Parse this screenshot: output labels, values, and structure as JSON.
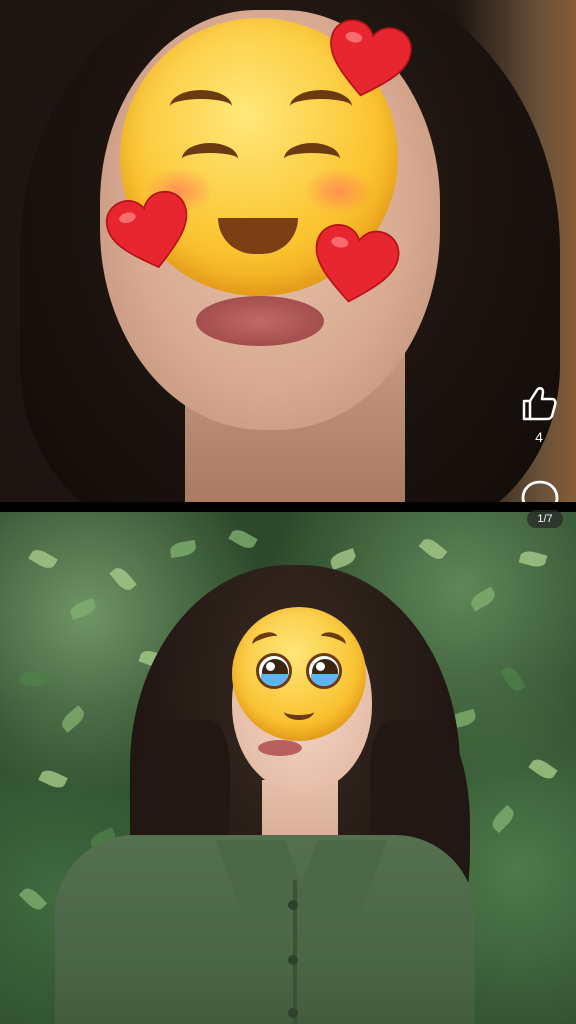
{
  "feed": {
    "post_top": {
      "emoji": "smiling-face-with-hearts",
      "actions": {
        "like_icon": "thumbs-up-icon",
        "like_count": "4",
        "comment_icon": "comment-bubble-icon"
      }
    },
    "page_indicator": "1/7",
    "post_bottom": {
      "emoji": "pleading-face"
    }
  },
  "colors": {
    "background": "#000000",
    "icon": "#ffffff",
    "heart": "#e8262f"
  }
}
